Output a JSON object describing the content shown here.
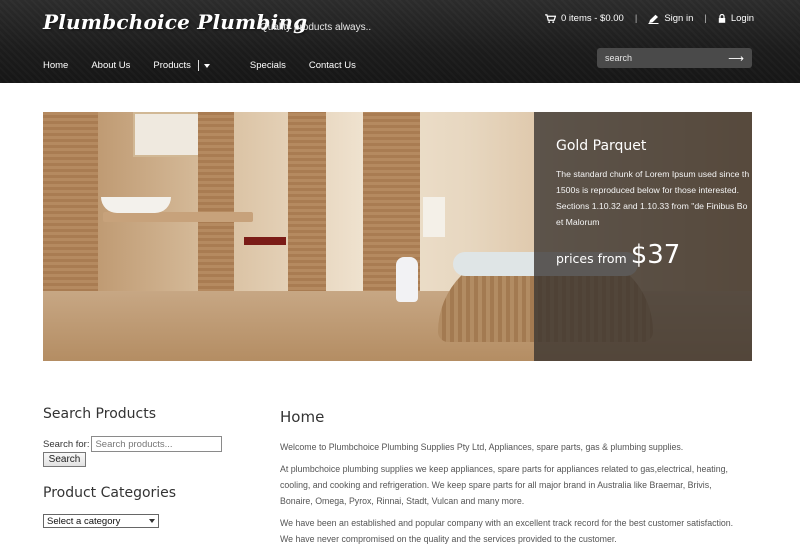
{
  "header": {
    "brand": "Plumbchoice Plumbing",
    "tagline": "Quality products always..",
    "cart_label": "0 items - $0.00",
    "signin_label": "Sign in",
    "login_label": "Login",
    "search_placeholder": "search"
  },
  "nav": {
    "items": [
      "Home",
      "About Us",
      "Products",
      "Specials",
      "Contact Us"
    ]
  },
  "hero": {
    "title": "Gold Parquet",
    "lines": [
      "The standard chunk of Lorem Ipsum used since th",
      "1500s is reproduced below for those interested.",
      "Sections 1.10.32 and 1.10.33 from \"de Finibus Bo",
      "et Malorum"
    ],
    "price_label": "prices from",
    "price_value": "$37"
  },
  "sidebar": {
    "search_heading": "Search Products",
    "search_label": "Search for:",
    "search_placeholder": "Search products...",
    "search_button": "Search",
    "categories_heading": "Product Categories",
    "category_selected": "Select a category"
  },
  "main": {
    "title": "Home",
    "p1": "Welcome to Plumbchoice Plumbing Supplies Pty Ltd, Appliances, spare parts, gas & plumbing supplies.",
    "p2_lines": [
      "At plumbchoice plumbing supplies we keep appliances, spare parts for appliances related to gas,electrical, heating,",
      "cooling, and cooking and refrigeration. We keep spare parts for all major brand in Australia like Braemar, Brivis,",
      "Bonaire, Omega, Pyrox, Rinnai, Stadt, Vulcan and many more."
    ],
    "p3_lines": [
      "We have been an established and popular company with an excellent track record for the best customer satisfaction.",
      "We have never compromised on the quality and the services provided to the customer."
    ]
  }
}
